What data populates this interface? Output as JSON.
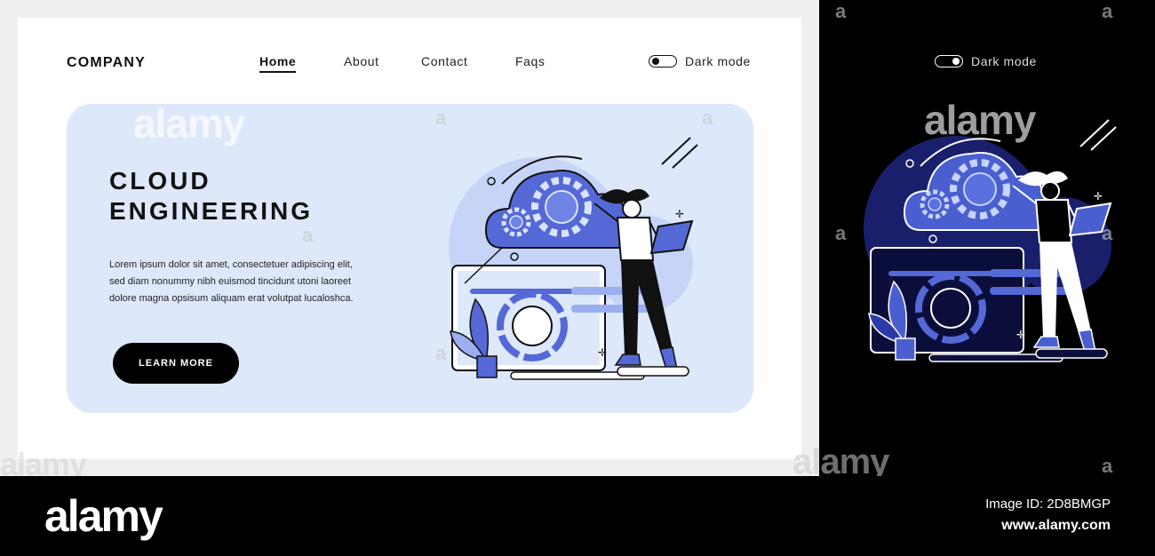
{
  "light": {
    "brand": "COMPANY",
    "nav": [
      {
        "label": "Home",
        "active": true
      },
      {
        "label": "About",
        "active": false
      },
      {
        "label": "Contact",
        "active": false
      },
      {
        "label": "Faqs",
        "active": false
      }
    ],
    "dark_mode_label": "Dark mode",
    "hero": {
      "title_line1": "CLOUD",
      "title_line2": "ENGINEERING",
      "body_line1": "Lorem ipsum dolor sit amet, consectetuer adipiscing elit,",
      "body_line2": "sed diam nonummy nibh euismod tincidunt utoni laoreet",
      "body_line3": "dolore magna opsisum aliquam erat volutpat lucaloshca.",
      "button_label": "LEARN MORE"
    }
  },
  "dark": {
    "dark_mode_label": "Dark mode"
  },
  "watermark": {
    "text": "alamy",
    "small": "a",
    "image_id": "Image ID: 2D8BMGP",
    "url": "www.alamy.com"
  },
  "colors": {
    "accent": "#5468d6",
    "accent_light": "#9aaef0",
    "hero_bg": "#dde8fb",
    "dark_circle": "#1a1f6b"
  },
  "icons": [
    "gear-icon",
    "cloud-icon",
    "laptop-icon",
    "plant-icon",
    "tablet-icon",
    "toggle-icon"
  ]
}
